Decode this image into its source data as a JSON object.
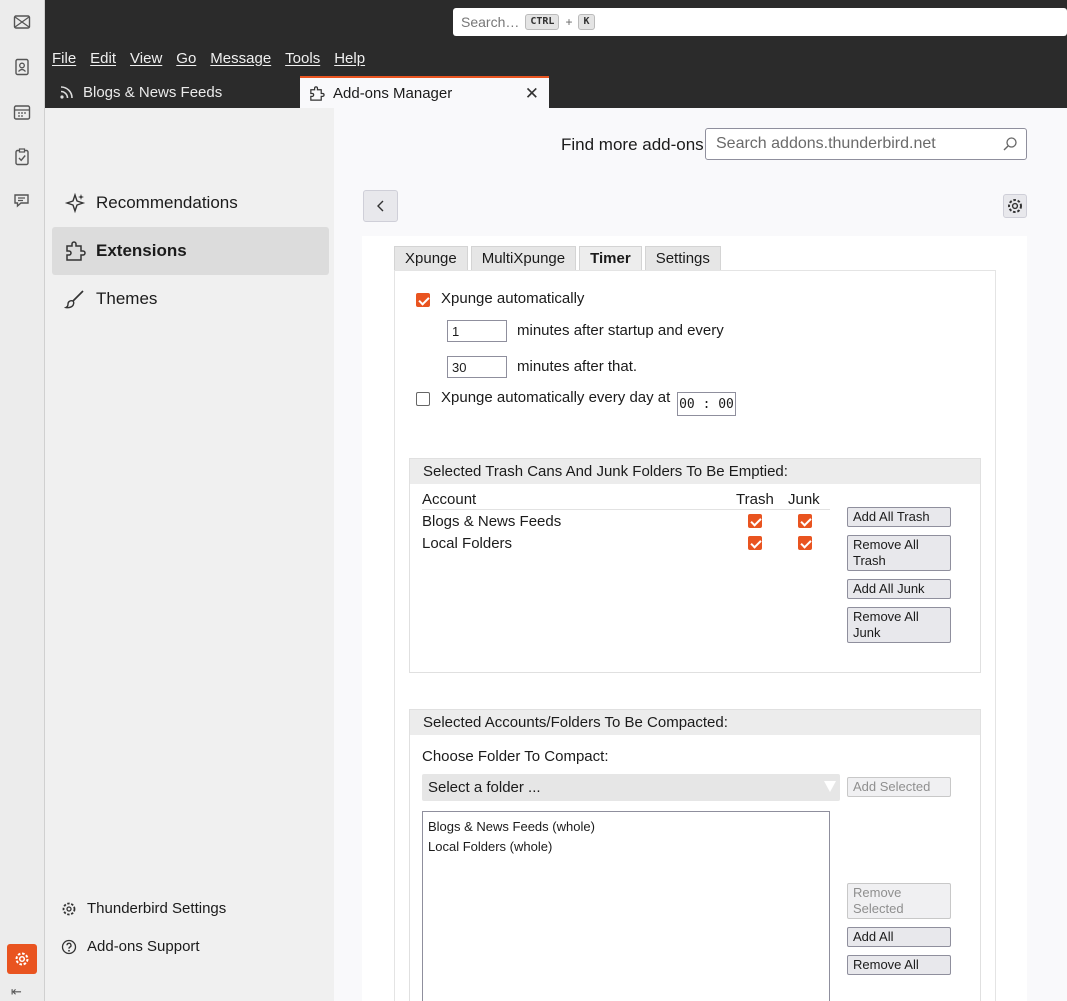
{
  "search": {
    "placeholder": "Search…",
    "key1": "CTRL",
    "plus": "+",
    "key2": "K"
  },
  "menu": [
    "File",
    "Edit",
    "View",
    "Go",
    "Message",
    "Tools",
    "Help"
  ],
  "tabs": {
    "feeds": "Blogs & News Feeds",
    "addons": "Add-ons Manager",
    "close": "✕"
  },
  "sidebar": {
    "categories": [
      "Recommendations",
      "Extensions",
      "Themes"
    ],
    "footer": {
      "settings": "Thunderbird Settings",
      "support": "Add-ons Support"
    }
  },
  "header": {
    "find_more": "Find more add-ons",
    "search_placeholder": "Search addons.thunderbird.net"
  },
  "subtabs": [
    "Xpunge",
    "MultiXpunge",
    "Timer",
    "Settings"
  ],
  "timer": {
    "auto_label": "Xpunge automatically",
    "auto_checked": true,
    "startup_value": "1",
    "startup_text": "minutes after startup and every",
    "interval_value": "30",
    "interval_text": "minutes after that.",
    "daily_label": "Xpunge automatically every day at",
    "daily_checked": false,
    "daily_time": "00 : 00"
  },
  "trash_group": {
    "title": "Selected Trash Cans And Junk Folders To Be Emptied:",
    "col_account": "Account",
    "col_trash": "Trash",
    "col_junk": "Junk",
    "rows": [
      {
        "account": "Blogs & News Feeds",
        "trash": true,
        "junk": true
      },
      {
        "account": "Local Folders",
        "trash": true,
        "junk": true
      }
    ],
    "buttons": [
      "Add All Trash",
      "Remove All Trash",
      "Add All Junk",
      "Remove All Junk"
    ]
  },
  "compact_group": {
    "title": "Selected Accounts/Folders To Be Compacted:",
    "choose_label": "Choose Folder To Compact:",
    "select_value": "Select a folder ...",
    "add_selected": "Add Selected",
    "list": [
      "Blogs & News Feeds (whole)",
      "Local Folders (whole)"
    ],
    "remove_selected": "Remove Selected",
    "add_all": "Add All",
    "remove_all": "Remove All"
  },
  "colors": {
    "accent": "#e95420",
    "titlebar": "#2b2b2b"
  }
}
